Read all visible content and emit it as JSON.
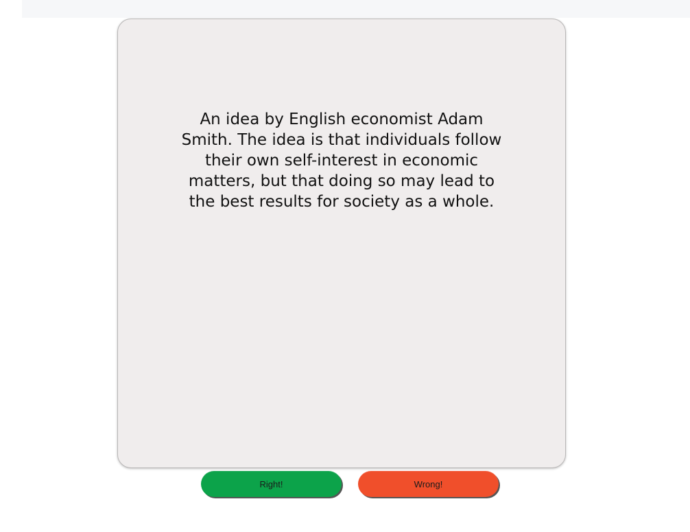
{
  "card": {
    "definition": "An idea by English economist Adam Smith. The idea is that individuals follow their own self-interest in economic matters, but that doing so may lead to the best results for society as a whole."
  },
  "actions": {
    "right_label": "Right!",
    "wrong_label": "Wrong!"
  },
  "colors": {
    "right_button": "#0ca34a",
    "wrong_button": "#f04f2b",
    "card_background": "#f0eded"
  }
}
